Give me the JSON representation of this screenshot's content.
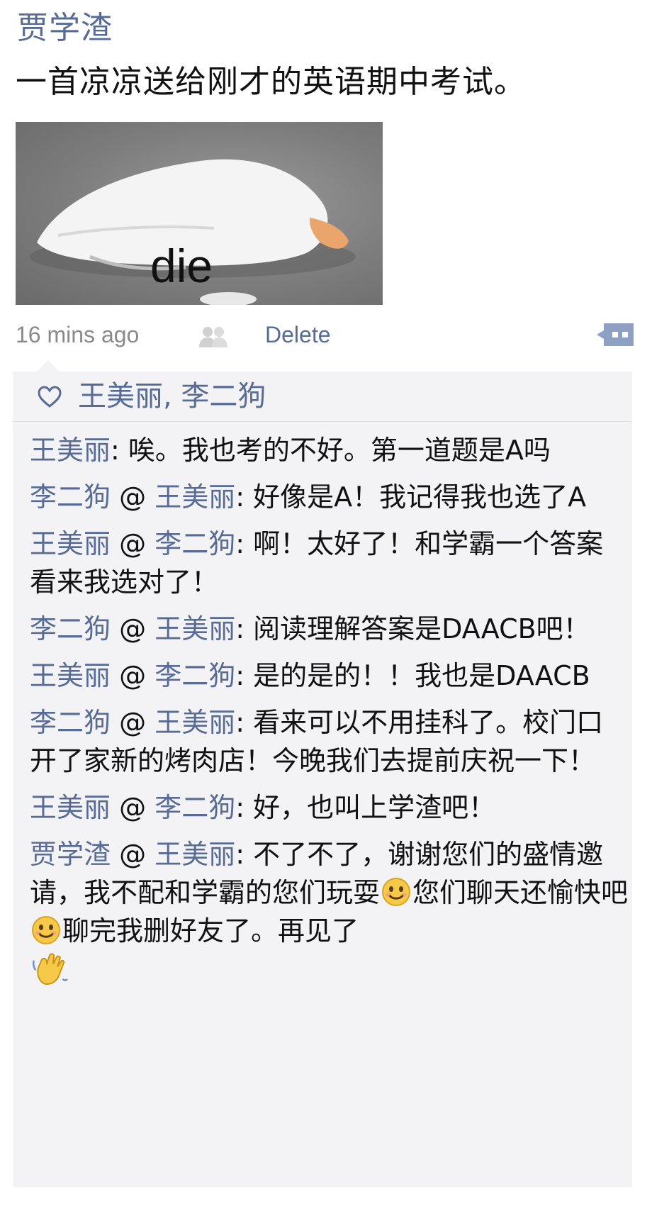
{
  "post": {
    "author": "贾学渣",
    "text": "一首凉凉送给刚才的英语期中考试。",
    "image_caption": "die",
    "time": "16 mins ago",
    "delete_label": "Delete"
  },
  "likes": {
    "names": "王美丽, 李二狗"
  },
  "comments": [
    {
      "from": "王美丽",
      "to": "",
      "sep": ": ",
      "text": "唉。我也考的不好。第一道题是A吗"
    },
    {
      "from": "李二狗",
      "to": "王美丽",
      "sep": ": ",
      "text": "好像是A！我记得我也选了A"
    },
    {
      "from": "王美丽",
      "to": "李二狗",
      "sep": ": ",
      "text": "啊！太好了！和学霸一个答案看来我选对了！"
    },
    {
      "from": "李二狗",
      "to": "王美丽",
      "sep": ": ",
      "text": "阅读理解答案是DAACB吧！"
    },
    {
      "from": "王美丽",
      "to": "李二狗",
      "sep": ": ",
      "text": "是的是的！！我也是DAACB"
    },
    {
      "from": "李二狗",
      "to": "王美丽",
      "sep": ": ",
      "text": "看来可以不用挂科了。校门口开了家新的烤肉店！今晚我们去提前庆祝一下！"
    },
    {
      "from": "王美丽",
      "to": "李二狗",
      "sep": ": ",
      "text": "好，也叫上学渣吧！"
    },
    {
      "from": "贾学渣",
      "to": "王美丽",
      "sep": ": ",
      "text_a": "不了不了，谢谢您们的盛情邀请，我不配和学霸的您们玩耍",
      "text_b": "您们聊天还愉快吧",
      "text_c": "聊完我删好友了。再见了"
    }
  ],
  "at_symbol": " @ ",
  "colors": {
    "link": "#576b95",
    "comment_bg": "#f3f3f5",
    "meta_gray": "#8a8a8a"
  },
  "icons": [
    "friends-visible-icon",
    "comment-bubble-icon",
    "heart-icon",
    "smile-emoji-icon",
    "waving-hand-emoji-icon"
  ]
}
